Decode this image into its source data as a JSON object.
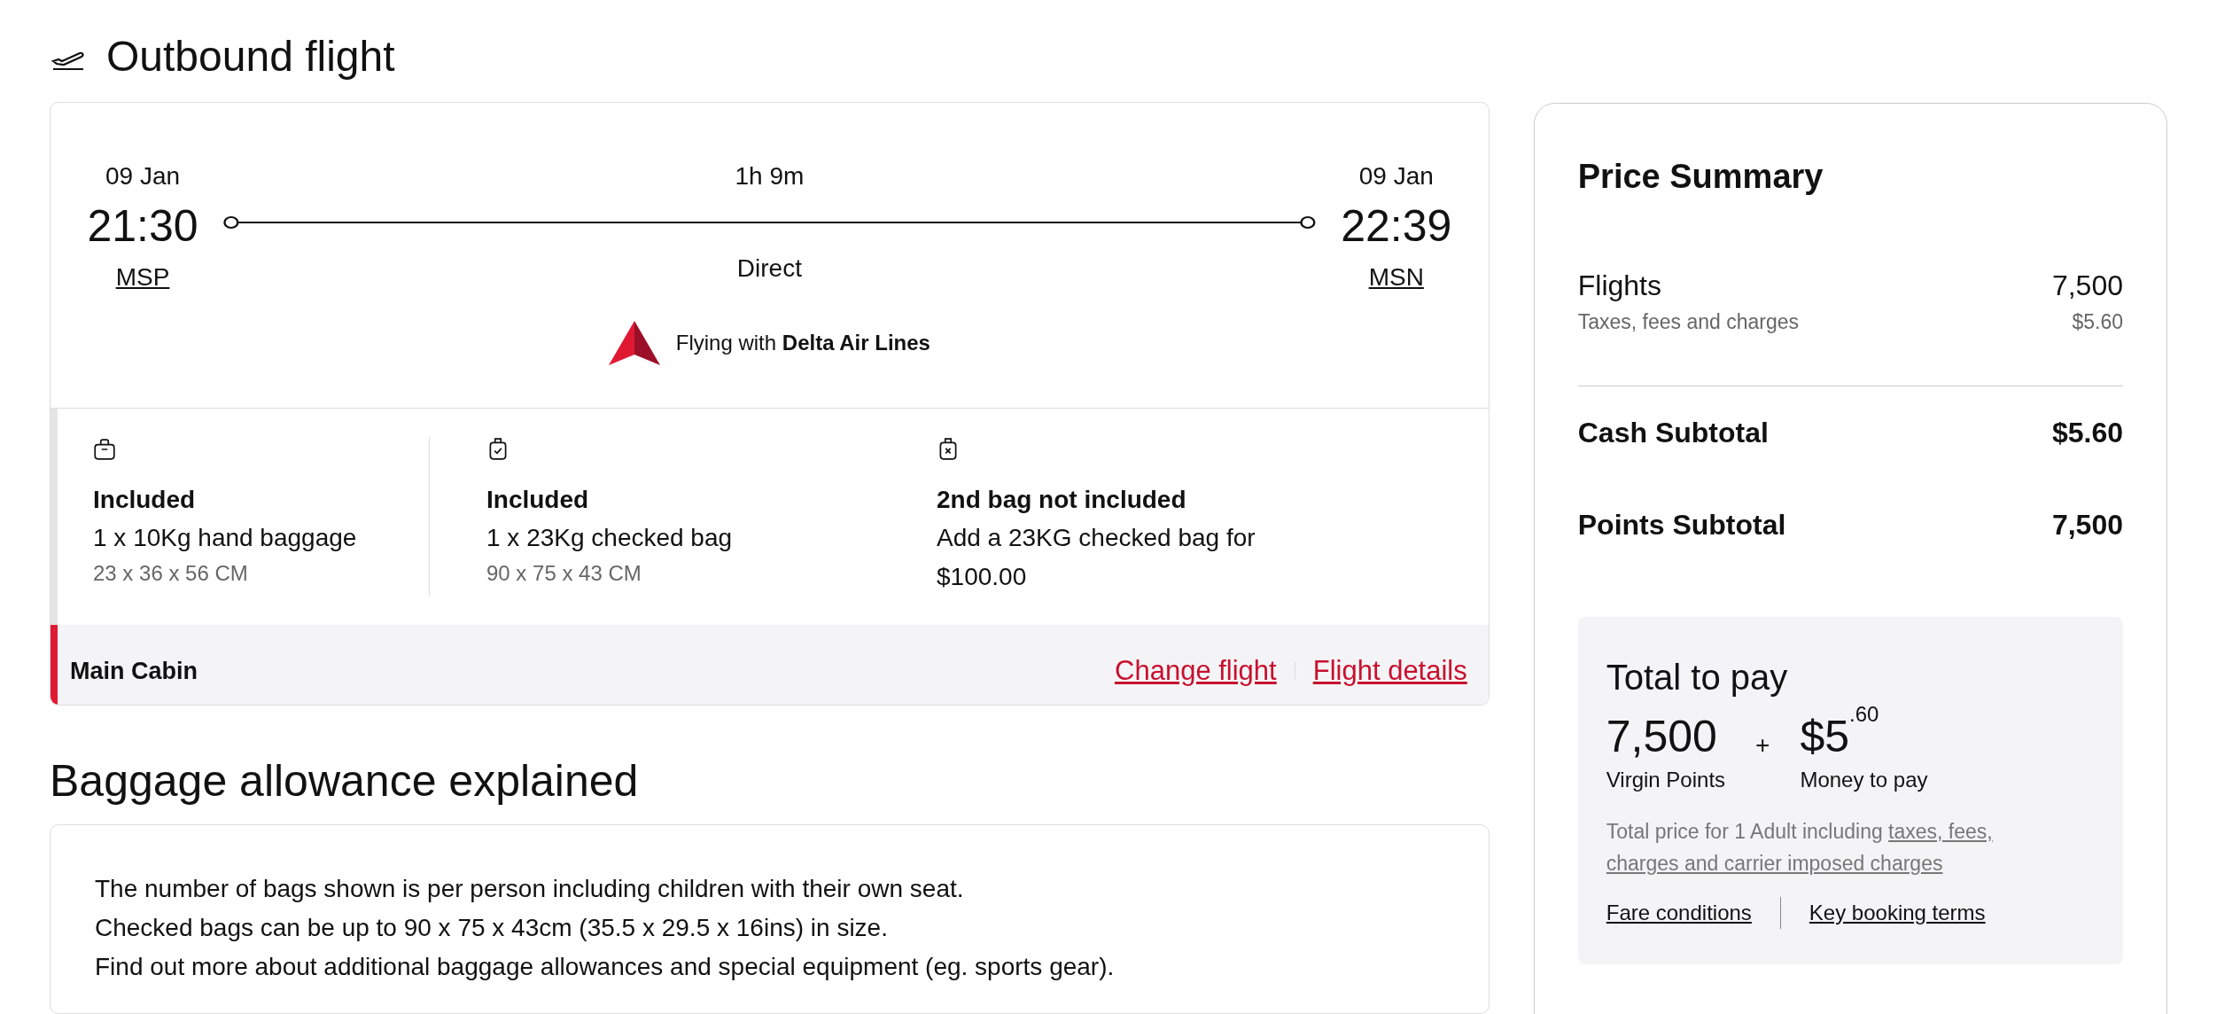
{
  "heading": "Outbound flight",
  "flight": {
    "depart_date": "09 Jan",
    "depart_time": "21:30",
    "depart_airport": "MSP",
    "duration": "1h 9m",
    "stops": "Direct",
    "arrive_date": "09 Jan",
    "arrive_time": "22:39",
    "arrive_airport": "MSN",
    "carrier": "Flying with **Delta Air Lines**"
  },
  "baggage": [
    {
      "kind": "hand",
      "title": "Included",
      "detail": "1 x 10Kg hand baggage",
      "size": "23 x 36 x 56 CM"
    },
    {
      "kind": "checked",
      "title": "Included",
      "detail": "1 x 23Kg checked bag",
      "size": "90 x 75 x 43 CM"
    },
    {
      "kind": "excluded",
      "title": "2nd bag not included",
      "detail": "Add a 23KG checked bag for $100.00"
    }
  ],
  "cabin": {
    "name": "Main Cabin",
    "links": [
      "Change flight",
      "Flight details"
    ]
  },
  "allowance": {
    "heading": "Baggage allowance explained",
    "lines": [
      "The number of bags shown is per person including children with their own seat.",
      "Checked bags can be up to 90 x 75 x 43cm (35.5 x 29.5 x 16ins) in size.",
      "Find out more about additional baggage allowances and special equipment (eg. sports gear)."
    ]
  },
  "price_summary": {
    "title": "Price Summary",
    "flights_label": "Flights",
    "flights_value": "7,500",
    "taxes_label": "Taxes, fees and charges",
    "taxes_value": "$5.60",
    "cash_label": "Cash Subtotal",
    "cash_value": "$5.60",
    "points_label": "Points Subtotal",
    "points_value": "7,500",
    "total": {
      "title": "Total to pay",
      "points": "7,500",
      "points_label": "Virgin Points",
      "plus": "+",
      "money_main": "$5",
      "money_cents": ".60",
      "money_label": "Money to pay",
      "note": "Total price for 1 Adult including",
      "note_links": [
        "taxes, fees,",
        "charges and carrier imposed charges"
      ],
      "links": [
        "Fare conditions",
        "Key booking terms"
      ]
    }
  }
}
